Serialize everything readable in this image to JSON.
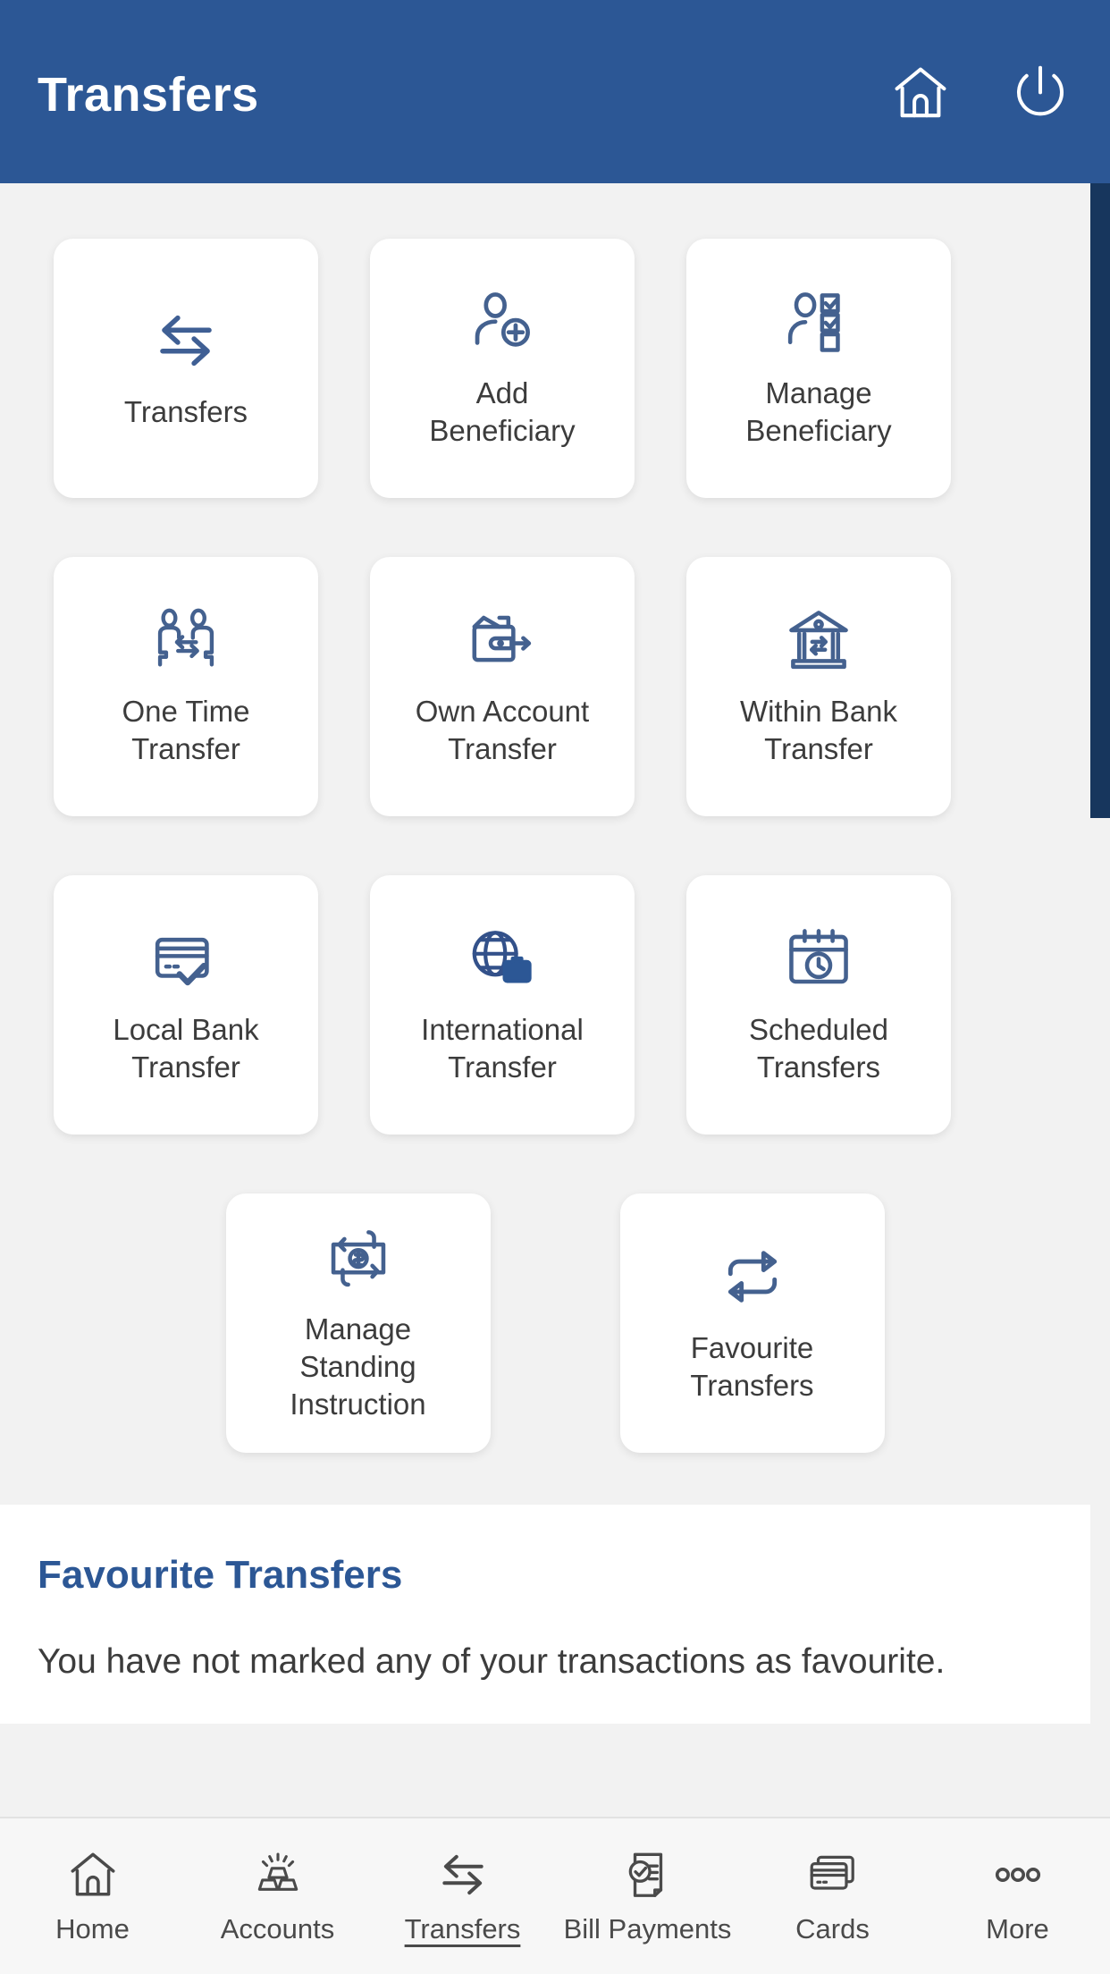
{
  "header": {
    "title": "Transfers",
    "home_icon": "home-icon",
    "power_icon": "power-icon"
  },
  "grid": {
    "rows": [
      [
        {
          "label": "Transfers",
          "icon": "transfer-arrows-icon"
        },
        {
          "label": "Add\nBeneficiary",
          "icon": "person-add-icon"
        },
        {
          "label": "Manage\nBeneficiary",
          "icon": "person-checklist-icon"
        }
      ],
      [
        {
          "label": "One Time\nTransfer",
          "icon": "two-people-exchange-icon"
        },
        {
          "label": "Own Account\nTransfer",
          "icon": "wallet-arrow-icon"
        },
        {
          "label": "Within Bank\nTransfer",
          "icon": "bank-exchange-icon"
        }
      ],
      [
        {
          "label": "Local Bank\nTransfer",
          "icon": "card-check-icon"
        },
        {
          "label": "International\nTransfer",
          "icon": "globe-briefcase-icon"
        },
        {
          "label": "Scheduled\nTransfers",
          "icon": "calendar-clock-icon"
        }
      ],
      [
        {
          "label": "Manage\nStanding\nInstruction",
          "icon": "banknote-recurring-icon"
        },
        {
          "label": "Favourite\nTransfers",
          "icon": "repeat-arrows-icon"
        }
      ]
    ]
  },
  "favourites": {
    "title": "Favourite Transfers",
    "empty_message": "You have not marked any of your transactions as favourite."
  },
  "bottom_nav": {
    "items": [
      {
        "label": "Home",
        "icon": "home-icon",
        "active": false
      },
      {
        "label": "Accounts",
        "icon": "gold-bars-icon",
        "active": false
      },
      {
        "label": "Transfers",
        "icon": "transfer-arrows-icon",
        "active": true
      },
      {
        "label": "Bill Payments",
        "icon": "document-check-icon",
        "active": false
      },
      {
        "label": "Cards",
        "icon": "cards-stack-icon",
        "active": false
      },
      {
        "label": "More",
        "icon": "three-dots-icon",
        "active": false
      }
    ]
  },
  "colors": {
    "header_blue": "#2c5795",
    "accent_blue": "#2c5795",
    "icon_blue": "#44618f",
    "page_bg": "#f2f2f2",
    "tile_bg": "#ffffff",
    "scrollbar": "#17365d",
    "label_gray": "#3c3c3c"
  }
}
